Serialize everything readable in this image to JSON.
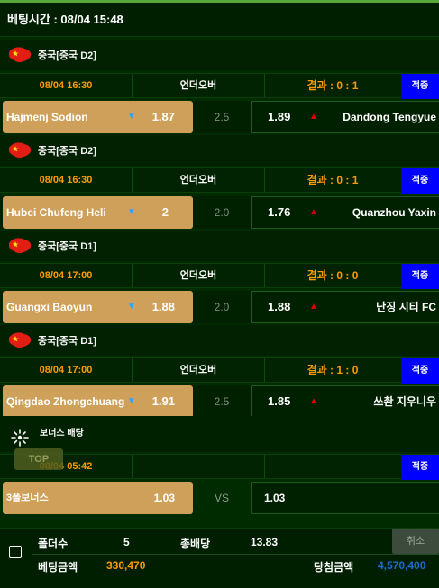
{
  "bet_time": {
    "label": "베팅시간 : 08/04 15:48"
  },
  "matches": [
    {
      "league": "중국[중국 D2]",
      "date": "08/04 16:30",
      "bet_type": "언더오버",
      "result": "결과 : 0 : 1",
      "apply_label": "적중",
      "home_team": "Hajmenj Sodion",
      "home_odds": "1.87",
      "handicap": "2.5",
      "away_odds": "1.89",
      "away_team": "Dandong Tengyue"
    },
    {
      "league": "중국[중국 D2]",
      "date": "08/04 16:30",
      "bet_type": "언더오버",
      "result": "결과 : 0 : 1",
      "apply_label": "적중",
      "home_team": "Hubei Chufeng Heli",
      "home_odds": "2",
      "handicap": "2.0",
      "away_odds": "1.76",
      "away_team": "Quanzhou Yaxin"
    },
    {
      "league": "중국[중국 D1]",
      "date": "08/04 17:00",
      "bet_type": "언더오버",
      "result": "결과 : 0 : 0",
      "apply_label": "적중",
      "home_team": "Guangxi Baoyun",
      "home_odds": "1.88",
      "handicap": "2.0",
      "away_odds": "1.88",
      "away_team": "난징 시티 FC"
    },
    {
      "league": "중국[중국 D1]",
      "date": "08/04 17:00",
      "bet_type": "언더오버",
      "result": "결과 : 1 : 0",
      "apply_label": "적중",
      "home_team": "Qingdao Zhongchuang",
      "home_odds": "1.91",
      "handicap": "2.5",
      "away_odds": "1.85",
      "away_team": "쓰촨 지우니우"
    }
  ],
  "bonus": {
    "header": "보너스 배당",
    "date": "08/04 05:42",
    "apply_label": "적중",
    "home_label": "3폴보너스",
    "home_odds": "1.03",
    "vs": "VS",
    "away_odds": "1.03"
  },
  "top_button": "TOP",
  "footer": {
    "folder_label": "폴더수",
    "folder_value": "5",
    "total_odds_label": "총배당",
    "total_odds_value": "13.83",
    "cancel_label": "취소",
    "bet_amount_label": "베팅금액",
    "bet_amount_value": "330,470",
    "win_amount_label": "당첨금액",
    "win_amount_value": "4,570,400"
  },
  "colors": {
    "background": "#002a00",
    "accent_orange": "#ff9a00",
    "home_cell": "#cfa05a",
    "apply_blue": "#0000ff",
    "win_blue": "#1a6ad8"
  }
}
